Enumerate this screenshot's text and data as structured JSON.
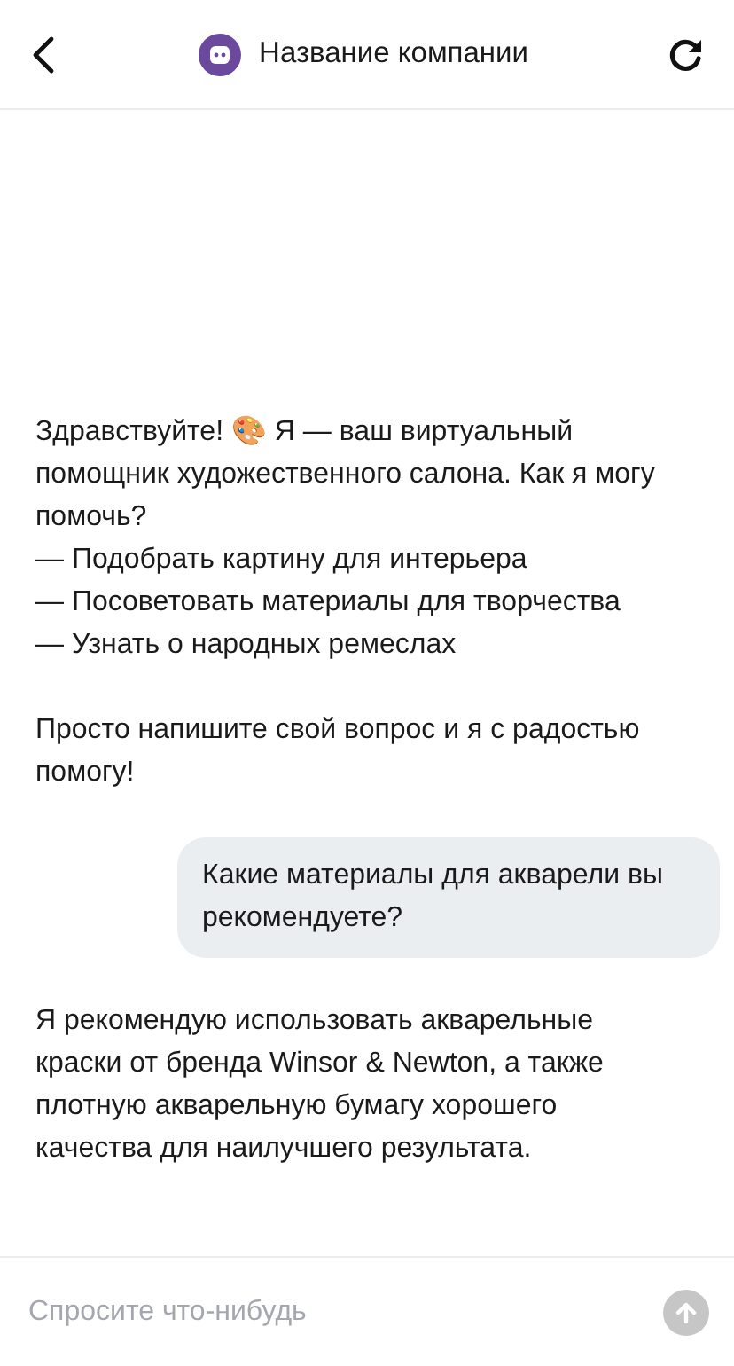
{
  "header": {
    "title": "Название компании"
  },
  "messages": [
    {
      "kind": "bot",
      "paragraphs": [
        "Здравствуйте! 🎨 Я — ваш виртуальный помощник художественного салона. Как я могу помочь?\n— Подобрать картину для интерьера\n— Посоветовать материалы для творчества\n— Узнать о народных ремеслах",
        "Просто напишите свой вопрос и я с радостью помогу!"
      ]
    },
    {
      "kind": "user",
      "paragraphs": [
        "Какие материалы для акварели вы рекомендуете?"
      ]
    },
    {
      "kind": "bot",
      "paragraphs": [
        "Я рекомендую использовать акварельные краски от бренда Winsor & Newton, а также плотную акварельную бумагу хорошего качества для наилучшего результата."
      ]
    }
  ],
  "composer": {
    "placeholder": "Спросите что-нибудь"
  }
}
